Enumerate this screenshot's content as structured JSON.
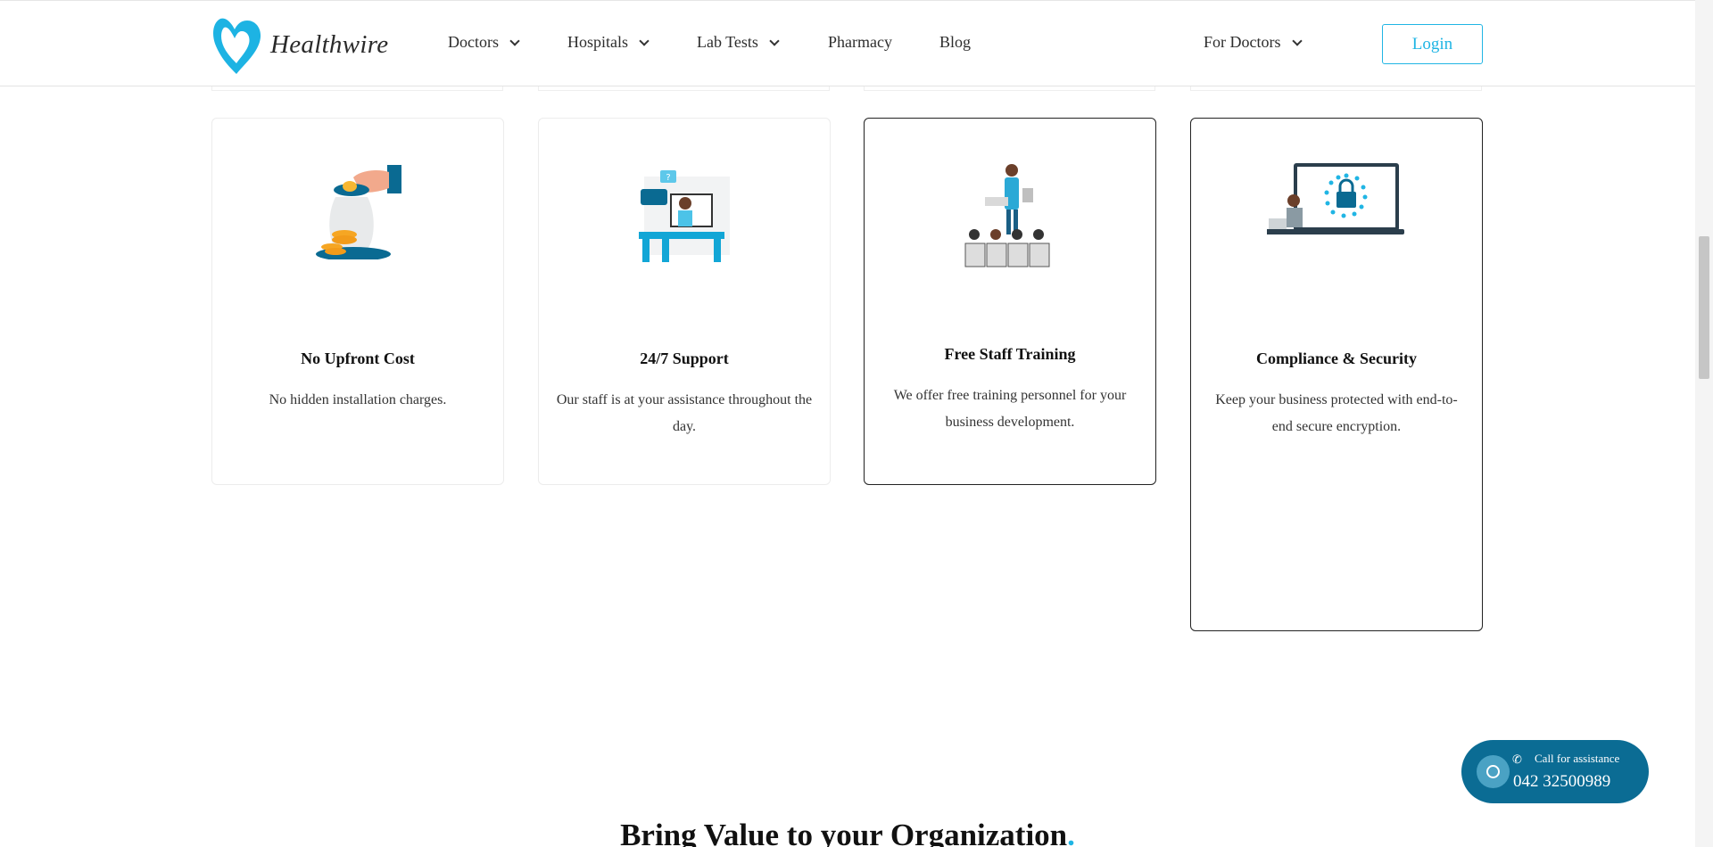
{
  "header": {
    "brand": "Healthwire",
    "nav": [
      {
        "label": "Doctors",
        "dropdown": true
      },
      {
        "label": "Hospitals",
        "dropdown": true
      },
      {
        "label": "Lab Tests",
        "dropdown": true
      },
      {
        "label": "Pharmacy",
        "dropdown": false
      },
      {
        "label": "Blog",
        "dropdown": false
      }
    ],
    "for_doctors": "For Doctors",
    "login": "Login"
  },
  "features": [
    {
      "title": "No Upfront Cost",
      "desc": "No hidden installation charges.",
      "icon": "money-jar-icon"
    },
    {
      "title": "24/7 Support",
      "desc": "Our staff is at your assistance throughout the day.",
      "icon": "support-agent-icon"
    },
    {
      "title": "Free Staff Training",
      "desc": "We offer free training personnel for your business development.",
      "icon": "training-presentation-icon"
    },
    {
      "title": "Compliance & Security",
      "desc": "Keep your business protected with end-to-end secure encryption.",
      "icon": "security-lock-laptop-icon"
    }
  ],
  "call_widget": {
    "label": "Call for assistance",
    "number": "042 32500989"
  },
  "section_heading": {
    "text": "Bring Value to your Organization",
    "dot": "."
  },
  "colors": {
    "accent": "#20b5e4",
    "call_bg": "#0b6c94"
  }
}
